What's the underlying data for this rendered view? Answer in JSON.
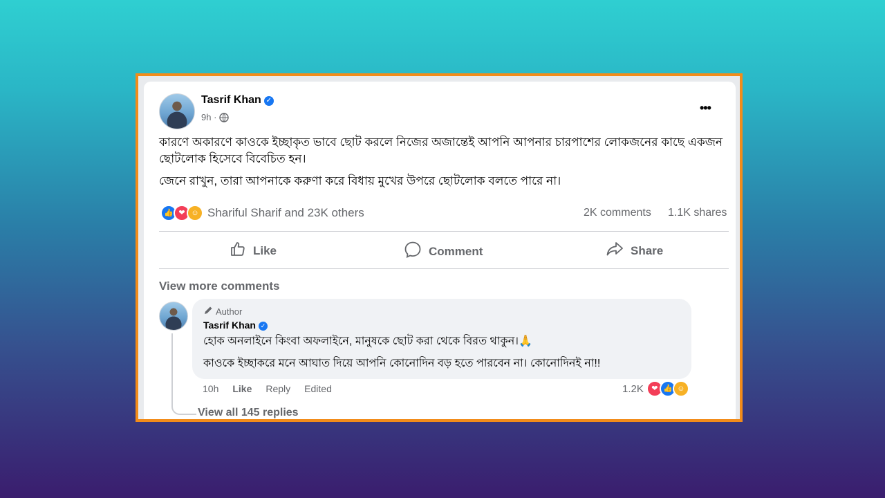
{
  "post": {
    "author": "Tasrif Khan",
    "time": "9h",
    "privacy_separator": "·",
    "paragraph1": "কারণে অকারণে কাওকে ইচ্ছাকৃত ভাবে ছোট করলে নিজের অজান্তেই আপনি আপনার চারপাশের লোকজনের কাছে একজন ছোটলোক হিসেবে বিবেচিত হন।",
    "paragraph2": "জেনে রাখুন, তারা আপনাকে করুণা করে বিধায় মুখের উপরে ছোটলোক বলতে পারে না।",
    "more_icon": "•••",
    "reactions_text": "Shariful Sharif and 23K others",
    "comments_count": "2K comments",
    "shares_count": "1.1K shares",
    "reaction_icons": [
      "like-icon",
      "love-icon",
      "care-icon"
    ]
  },
  "actions": {
    "like": "Like",
    "comment": "Comment",
    "share": "Share"
  },
  "comments": {
    "view_more": "View more comments",
    "author_badge": "Author",
    "commenter": "Tasrif Khan",
    "line1": "হোক অনলাইনে কিংবা অফলাইনে, মানুষকে ছোট করা থেকে বিরত থাকুন।🙏",
    "line2": "কাওকে ইচ্ছাকরে মনে আঘাত দিয়ে আপনি কোনোদিন বড় হতে পারবেন না। কোনোদিনই না!!",
    "time": "10h",
    "like": "Like",
    "reply": "Reply",
    "edited": "Edited",
    "reaction_count": "1.2K",
    "view_replies": "View all 145 replies"
  },
  "colors": {
    "accent": "#1877f2",
    "frame_border": "#f28c1a",
    "love": "#f33e58",
    "care": "#f7b125"
  }
}
